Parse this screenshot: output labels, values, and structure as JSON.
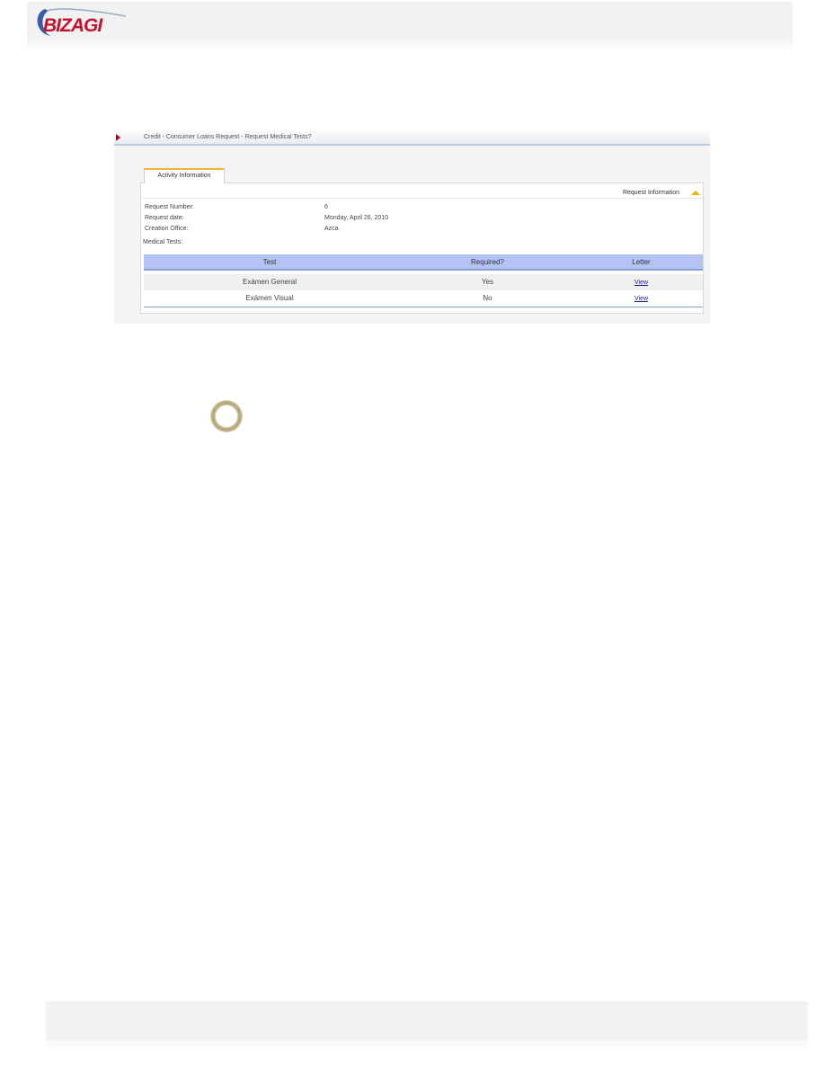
{
  "header": {
    "logo_text": "BIZAGI"
  },
  "breadcrumb": {
    "text": "Credit - Consumer Loans Request - Request Medical Tests?"
  },
  "tabs": [
    {
      "label": "Activity Information"
    }
  ],
  "section": {
    "title": "Request Information"
  },
  "fields": [
    {
      "label": "Request Number:",
      "value": "6"
    },
    {
      "label": "Request date:",
      "value": "Monday, April 26, 2010"
    },
    {
      "label": "Creation Office:",
      "value": "Azca"
    }
  ],
  "medical_tests": {
    "label": "Medical Tests:",
    "columns": [
      "Test",
      "Required?",
      "Letter"
    ],
    "rows": [
      {
        "test": "Exámen General",
        "required": "Yes",
        "letter": "View"
      },
      {
        "test": "Exámen Visual",
        "required": "No",
        "letter": "View"
      }
    ]
  },
  "colors": {
    "logo_red": "#c8102e",
    "logo_swoosh": "#3b5ea8",
    "tab_accent": "#f2b33d",
    "grid_header": "#b4c2f4",
    "ring": "#b8ac80"
  }
}
